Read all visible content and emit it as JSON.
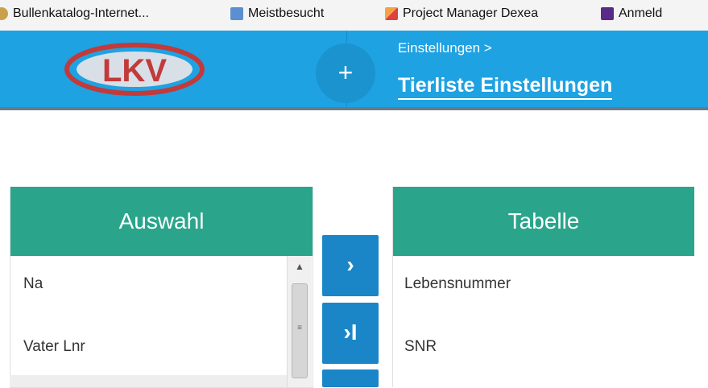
{
  "bookmarks": [
    {
      "label": "Bullenkatalog-Internet...",
      "icon": "bookmark-globe-icon"
    },
    {
      "label": "Meistbesucht",
      "icon": "folder-icon"
    },
    {
      "label": "Project Manager Dexea",
      "icon": "dexea-icon"
    },
    {
      "label": "Anmeld",
      "icon": "bookmark-purple-icon"
    }
  ],
  "header": {
    "logo_text": "LKV",
    "plus_label": "+",
    "breadcrumb": "Einstellungen >",
    "title": "Tierliste Einstellungen"
  },
  "left_panel": {
    "title": "Auswahl",
    "items": [
      "Na",
      "Vater Lnr"
    ]
  },
  "right_panel": {
    "title": "Tabelle",
    "items": [
      "Lebensnummer",
      "SNR"
    ]
  },
  "transfer_buttons": [
    {
      "label": "›",
      "icon": "move-right-icon"
    },
    {
      "label": "›I",
      "icon": "move-all-right-icon"
    }
  ],
  "scrollbar": {
    "up_glyph": "▲",
    "grip": "≡"
  },
  "colors": {
    "header": "#1ea2e2",
    "panel_header": "#2aa58b",
    "button": "#1a86c8"
  }
}
